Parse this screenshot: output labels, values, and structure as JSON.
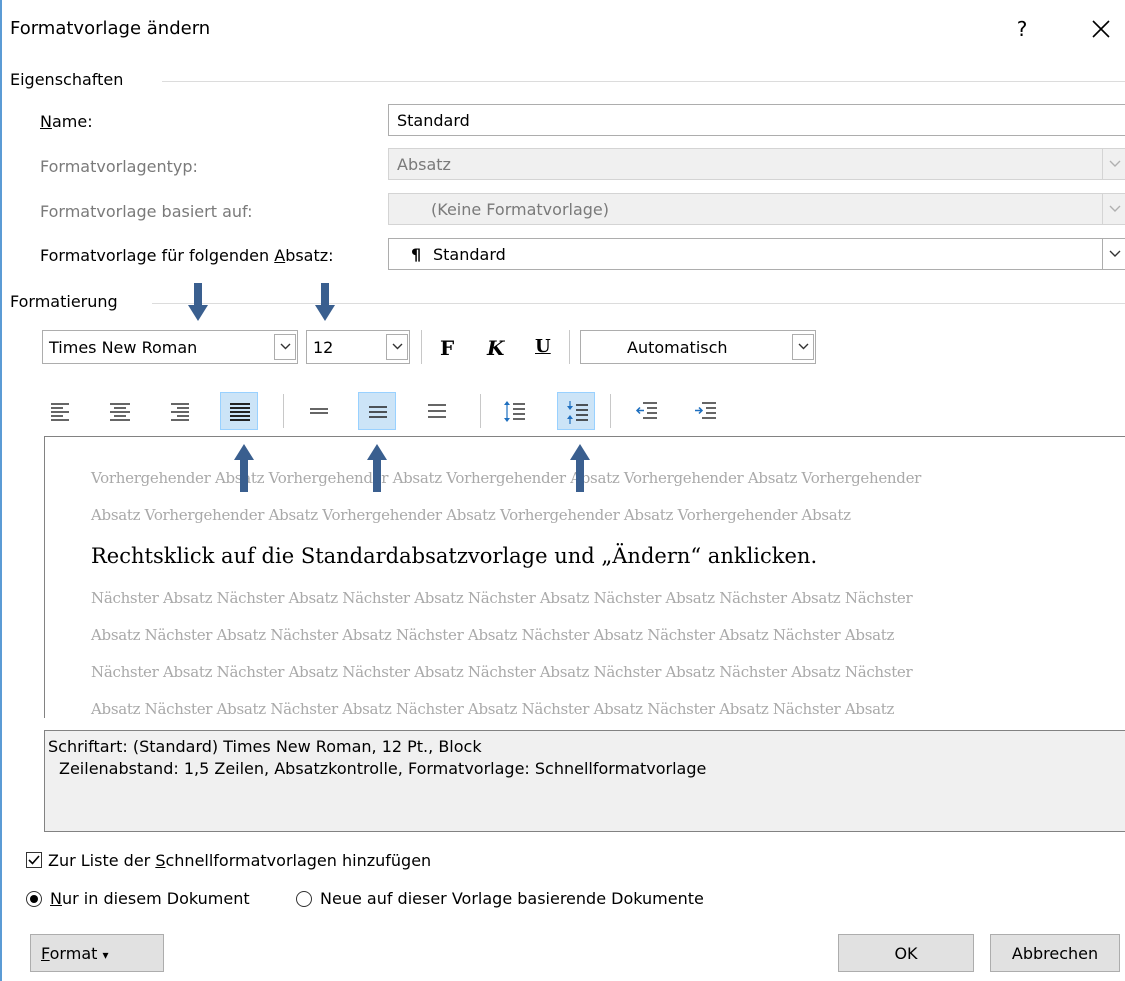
{
  "dialog": {
    "title": "Formatvorlage ändern",
    "help_label": "?",
    "close_label": "✕"
  },
  "properties": {
    "section_title": "Eigenschaften",
    "name_label_underlined": "N",
    "name_label_rest": "ame:",
    "name_value": "Standard",
    "type_label": "Formatvorlagentyp:",
    "type_value": "Absatz",
    "based_on_label": "Formatvorlage basiert auf:",
    "based_on_value": "(Keine Formatvorlage)",
    "next_label_prefix": "Formatvorlage für folgenden ",
    "next_label_underlined": "A",
    "next_label_rest": "bsatz:",
    "next_value_pilcrow": "¶",
    "next_value": "Standard"
  },
  "formatting": {
    "section_title": "Formatierung",
    "font_name": "Times New Roman",
    "font_size": "12",
    "bold_label": "F",
    "italic_label": "K",
    "underline_label": "U",
    "color_value": "Automatisch"
  },
  "toolbar": {
    "selected_alignment": "justify",
    "selected_spacing": "1.5",
    "selected_paragraph_spacing": "decrease"
  },
  "preview": {
    "previous_lines": [
      "Vorhergehender Absatz Vorhergehender Absatz Vorhergehender Absatz Vorhergehender Absatz Vorhergehender",
      "Absatz Vorhergehender Absatz Vorhergehender Absatz Vorhergehender Absatz Vorhergehender Absatz"
    ],
    "main_text": "Rechtsklick auf die Standardabsatzvorlage und „Ändern“ anklicken.",
    "next_lines": [
      "Nächster Absatz Nächster Absatz Nächster Absatz Nächster Absatz Nächster Absatz Nächster Absatz Nächster",
      "Absatz Nächster Absatz Nächster Absatz Nächster Absatz Nächster Absatz Nächster Absatz Nächster Absatz",
      "Nächster Absatz Nächster Absatz Nächster Absatz Nächster Absatz Nächster Absatz Nächster Absatz Nächster",
      "Absatz Nächster Absatz Nächster Absatz Nächster Absatz Nächster Absatz Nächster Absatz Nächster Absatz"
    ]
  },
  "description": {
    "line1": "Schriftart: (Standard) Times New Roman, 12 Pt., Block",
    "line2": "Zeilenabstand:  1,5 Zeilen, Absatzkontrolle, Formatvorlage: Schnellformatvorlage"
  },
  "options": {
    "add_to_gallery_prefix": "Zur Liste der ",
    "add_to_gallery_underlined": "S",
    "add_to_gallery_rest": "chnellformatvorlagen hinzufügen",
    "add_to_gallery_checked": true,
    "only_this_doc_underlined": "N",
    "only_this_doc_rest": "ur in diesem Dokument",
    "only_this_doc_selected": true,
    "new_docs_label": "Neue auf dieser Vorlage basierende Dokumente",
    "new_docs_selected": false
  },
  "buttons": {
    "format_underlined": "F",
    "format_rest": "ormat",
    "format_caret": "▾",
    "ok": "OK",
    "cancel": "Abbrechen"
  },
  "colors": {
    "accent": "#5b9bd5",
    "annotation_arrow": "#3a5f8f",
    "selected_button_bg": "#cce4f7",
    "preview_gray": "#a9a9a9"
  },
  "annotations": {
    "arrow_icons": [
      "arrow-down-icon",
      "arrow-down-icon",
      "arrow-up-icon",
      "arrow-up-icon",
      "arrow-up-icon"
    ]
  }
}
